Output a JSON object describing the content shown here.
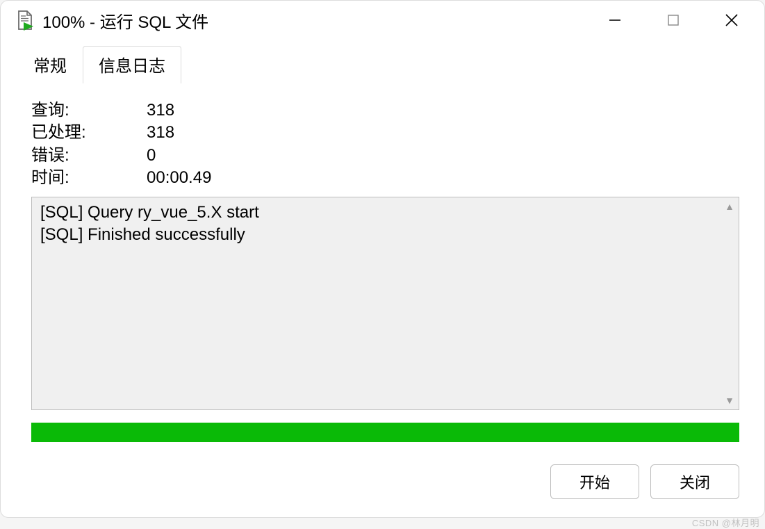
{
  "titlebar": {
    "title": "100% - 运行 SQL 文件"
  },
  "tabs": {
    "general": "常规",
    "log": "信息日志"
  },
  "stats": {
    "query_label": "查询:",
    "query_value": "318",
    "processed_label": "已处理:",
    "processed_value": "318",
    "errors_label": "错误:",
    "errors_value": "0",
    "time_label": "时间:",
    "time_value": "00:00.49"
  },
  "log": {
    "text": "[SQL] Query ry_vue_5.X start\n[SQL] Finished successfully"
  },
  "buttons": {
    "start": "开始",
    "close": "关闭"
  },
  "watermark": "CSDN @林月明"
}
